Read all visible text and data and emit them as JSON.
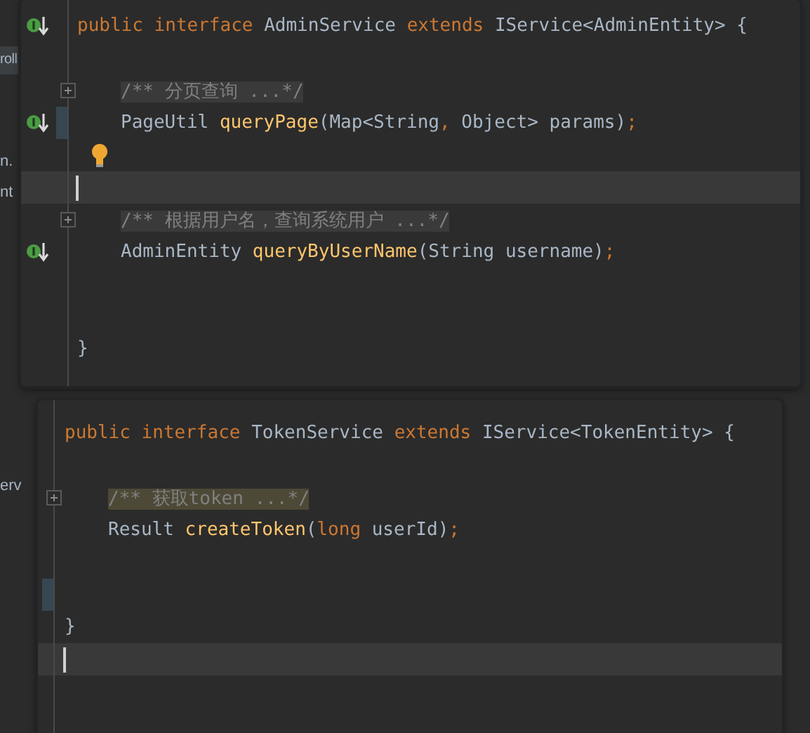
{
  "background": {
    "side_texts": [
      {
        "text": "roll",
        "band": true
      },
      {
        "text": "n.",
        "band": false
      },
      {
        "text": "nt",
        "band": false
      },
      {
        "text": "erv",
        "band": false
      }
    ]
  },
  "editors": [
    {
      "lines": [
        {
          "implemented": true,
          "changed": false,
          "foldable": false,
          "bulb": false,
          "tokens": [
            {
              "text": "public interface ",
              "kind": "keyword"
            },
            {
              "text": "AdminService ",
              "kind": "plain"
            },
            {
              "text": "extends ",
              "kind": "keyword"
            },
            {
              "text": "IService<AdminEntity> {",
              "kind": "plain"
            }
          ],
          "children": [
            {
              "implemented": false,
              "changed": false,
              "foldable": false,
              "bulb": false
            },
            {
              "implemented": false,
              "changed": false,
              "foldable": true,
              "bulb": false,
              "tokens": [
                {
                  "text": "/** 分页查询 ...*/",
                  "kind": "folded"
                }
              ]
            },
            {
              "implemented": true,
              "changed": true,
              "foldable": false,
              "bulb": false,
              "tokens": [
                {
                  "text": "PageUtil ",
                  "kind": "plain"
                },
                {
                  "text": "queryPage",
                  "kind": "method"
                },
                {
                  "text": "(Map<String",
                  "kind": "plain"
                },
                {
                  "text": ", ",
                  "kind": "keyword"
                },
                {
                  "text": "Object> params)",
                  "kind": "plain"
                },
                {
                  "text": ";",
                  "kind": "keyword"
                }
              ]
            },
            {
              "implemented": false,
              "changed": false,
              "foldable": false,
              "bulb": true
            },
            {
              "current": true,
              "implemented": false,
              "changed": false,
              "foldable": false,
              "bulb": false
            },
            {
              "implemented": false,
              "changed": false,
              "foldable": true,
              "bulb": false,
              "tokens": [
                {
                  "text": "/** 根据用户名，查询系统用户 ...*/",
                  "kind": "folded"
                }
              ]
            },
            {
              "implemented": true,
              "changed": false,
              "foldable": false,
              "bulb": false,
              "tokens": [
                {
                  "text": "AdminEntity ",
                  "kind": "plain"
                },
                {
                  "text": "queryByUserName",
                  "kind": "method"
                },
                {
                  "text": "(String username)",
                  "kind": "plain"
                },
                {
                  "text": ";",
                  "kind": "keyword"
                }
              ]
            },
            {
              "implemented": false,
              "changed": false,
              "foldable": false,
              "bulb": false
            },
            {
              "implemented": false,
              "changed": false,
              "foldable": false,
              "bulb": false
            }
          ]
        },
        {
          "implemented": false,
          "changed": false,
          "foldable": false,
          "bulb": false,
          "tokens": [
            {
              "text": "}",
              "kind": "plain"
            }
          ]
        }
      ]
    },
    {
      "lines": [
        {
          "implemented": false,
          "changed": false,
          "foldable": false,
          "bulb": false,
          "tokens": [
            {
              "text": "public interface ",
              "kind": "keyword"
            },
            {
              "text": "TokenService ",
              "kind": "plain"
            },
            {
              "text": "extends ",
              "kind": "keyword"
            },
            {
              "text": "IService<TokenEntity> {",
              "kind": "plain"
            }
          ],
          "children": [
            {
              "implemented": false,
              "changed": false,
              "foldable": false,
              "bulb": false
            },
            {
              "implemented": false,
              "changed": false,
              "foldable": true,
              "bulb": false,
              "tokens": [
                {
                  "text": "/** 获取token ...*/",
                  "kind": "folded-match"
                }
              ]
            },
            {
              "implemented": false,
              "changed": false,
              "foldable": false,
              "bulb": false,
              "tokens": [
                {
                  "text": "Result ",
                  "kind": "plain"
                },
                {
                  "text": "createToken",
                  "kind": "method"
                },
                {
                  "text": "(",
                  "kind": "plain"
                },
                {
                  "text": "long ",
                  "kind": "keyword"
                },
                {
                  "text": "userId)",
                  "kind": "plain"
                },
                {
                  "text": ";",
                  "kind": "keyword"
                }
              ]
            },
            {
              "implemented": false,
              "changed": false,
              "foldable": false,
              "bulb": false
            },
            {
              "implemented": false,
              "changed": true,
              "foldable": false,
              "bulb": false
            }
          ]
        },
        {
          "implemented": false,
          "changed": false,
          "foldable": false,
          "bulb": false,
          "tokens": [
            {
              "text": "}",
              "kind": "plain"
            }
          ]
        },
        {
          "current": true,
          "implemented": false,
          "changed": false,
          "foldable": false,
          "bulb": false
        }
      ]
    }
  ]
}
